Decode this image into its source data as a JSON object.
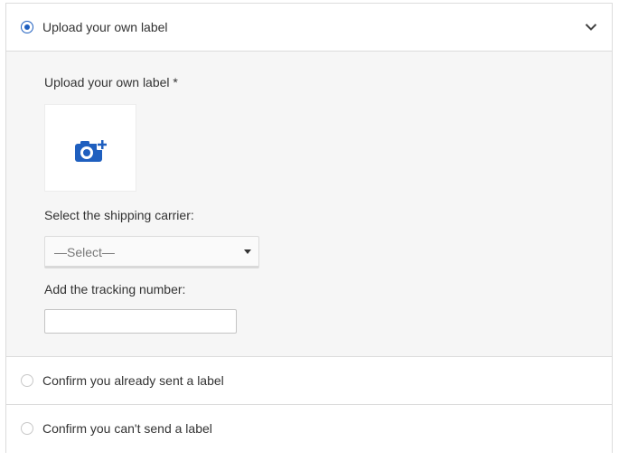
{
  "options": {
    "upload": {
      "label": "Upload your own label",
      "selected": true
    },
    "confirm_sent": {
      "label": "Confirm you already sent a label",
      "selected": false
    },
    "cannot_send": {
      "label": "Confirm you can't send a label",
      "selected": false
    }
  },
  "upload_section": {
    "label": "Upload your own label *",
    "upload_icon": "camera-add-icon",
    "carrier_label": "Select the shipping carrier:",
    "carrier_select_value": "—Select—",
    "tracking_label": "Add the tracking number:",
    "tracking_value": "",
    "tracking_placeholder": ""
  },
  "icons": {
    "expand": "chevron-down-icon"
  },
  "colors": {
    "accent": "#1f5fbf",
    "panel_background": "#f6f6f6",
    "border": "#dcdcdc"
  }
}
